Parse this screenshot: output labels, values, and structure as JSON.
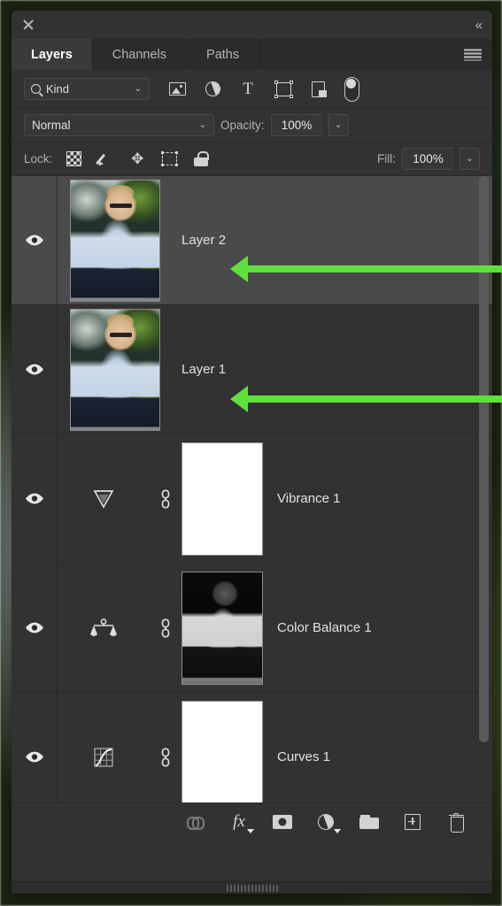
{
  "window": {
    "close_icon": "close-icon",
    "collapse_icon": "double-chevron-left-icon"
  },
  "tabs": [
    {
      "label": "Layers",
      "active": true
    },
    {
      "label": "Channels",
      "active": false
    },
    {
      "label": "Paths",
      "active": false
    }
  ],
  "menu_icon": "hamburger-menu-icon",
  "filter": {
    "kind_label": "Kind",
    "search_icon": "search-icon",
    "chevron": "⌄",
    "type_filters": [
      {
        "name": "pixel-layer-filter-icon"
      },
      {
        "name": "adjustment-layer-filter-icon"
      },
      {
        "name": "type-layer-filter-icon"
      },
      {
        "name": "shape-layer-filter-icon"
      },
      {
        "name": "smart-object-filter-icon"
      }
    ],
    "toggle_name": "filter-enable-toggle"
  },
  "blend": {
    "mode": "Normal",
    "opacity_label": "Opacity:",
    "opacity_value": "100%",
    "chevron": "⌄"
  },
  "lock": {
    "label": "Lock:",
    "buttons": [
      {
        "name": "lock-transparent-pixels-icon"
      },
      {
        "name": "lock-image-pixels-icon"
      },
      {
        "name": "lock-position-icon"
      },
      {
        "name": "lock-nesting-icon"
      },
      {
        "name": "lock-all-icon"
      }
    ],
    "fill_label": "Fill:",
    "fill_value": "100%"
  },
  "layers": [
    {
      "name": "Layer 2",
      "type": "pixel",
      "visible": true,
      "selected": true,
      "has_mask": false,
      "annotated": true
    },
    {
      "name": "Layer 1",
      "type": "pixel",
      "visible": true,
      "selected": false,
      "has_mask": false,
      "annotated": true
    },
    {
      "name": "Vibrance 1",
      "type": "adjustment",
      "adjustment_icon": "vibrance-icon",
      "visible": true,
      "selected": false,
      "has_mask": true,
      "mask_kind": "white",
      "link_icon": "mask-link-icon",
      "annotated": false
    },
    {
      "name": "Color Balance 1",
      "type": "adjustment",
      "adjustment_icon": "color-balance-icon",
      "visible": true,
      "selected": false,
      "has_mask": true,
      "mask_kind": "grayscale-photo",
      "link_icon": "mask-link-icon",
      "annotated": false
    },
    {
      "name": "Curves 1",
      "type": "adjustment",
      "adjustment_icon": "curves-icon",
      "visible": true,
      "selected": false,
      "has_mask": true,
      "mask_kind": "white",
      "link_icon": "mask-link-icon",
      "annotated": false
    }
  ],
  "bottom_toolbar": [
    {
      "name": "link-layers-button"
    },
    {
      "name": "layer-style-fx-button"
    },
    {
      "name": "add-layer-mask-button"
    },
    {
      "name": "new-adjustment-layer-button"
    },
    {
      "name": "new-group-button"
    },
    {
      "name": "new-layer-button"
    },
    {
      "name": "delete-layer-button"
    }
  ],
  "annotation": {
    "color": "#5FE03C",
    "arrows": [
      {
        "target": "Layer 2"
      },
      {
        "target": "Layer 1"
      }
    ]
  },
  "colors": {
    "panel_bg": "#323232",
    "tab_bg": "#2B2B2B",
    "tab_active_bg": "#3A3A3A",
    "row_selected": "#4A4A4A",
    "text": "#D6D6D6",
    "accent_green": "#5FE03C"
  }
}
